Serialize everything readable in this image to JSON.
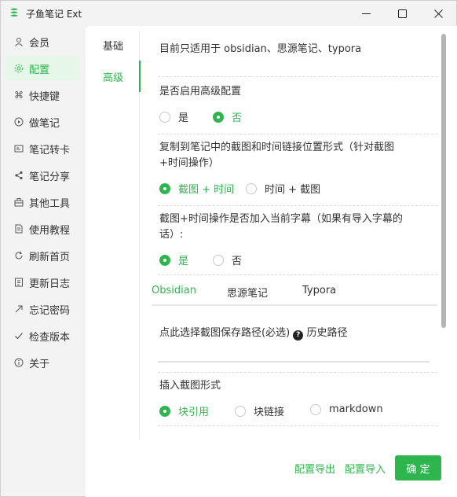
{
  "window": {
    "title": "子鱼笔记 Ext",
    "controls": {
      "minimize": "minimize-icon",
      "maximize": "maximize-icon",
      "close": "close-icon"
    }
  },
  "sidebar": {
    "items": [
      {
        "label": "会员",
        "icon": "user-icon"
      },
      {
        "label": "配置",
        "icon": "gear-icon",
        "active": true
      },
      {
        "label": "快捷键",
        "icon": "command-icon"
      },
      {
        "label": "做笔记",
        "icon": "play-circle-icon"
      },
      {
        "label": "笔记转卡",
        "icon": "card-icon"
      },
      {
        "label": "笔记分享",
        "icon": "share-icon"
      },
      {
        "label": "其他工具",
        "icon": "toolbox-icon"
      },
      {
        "label": "使用教程",
        "icon": "document-icon"
      },
      {
        "label": "刷新首页",
        "icon": "refresh-icon"
      },
      {
        "label": "更新日志",
        "icon": "log-icon"
      },
      {
        "label": "忘记密码",
        "icon": "arrow-up-right-icon"
      },
      {
        "label": "检查版本",
        "icon": "check-icon"
      },
      {
        "label": "关于",
        "icon": "info-icon"
      }
    ]
  },
  "settings_tabs": [
    {
      "label": "基础"
    },
    {
      "label": "高级",
      "active": true
    }
  ],
  "content": {
    "note": "目前只适用于 obsidian、思源笔记、typora",
    "enable_advanced": {
      "question": "是否启用高级配置",
      "options": [
        "是",
        "否"
      ],
      "selected": "否"
    },
    "link_position": {
      "question_line1": "复制到笔记中的截图和时间链接位置形式（针对截图",
      "question_line2": "+时间操作）",
      "options": [
        "截图 + 时间",
        "时间 + 截图"
      ],
      "selected": "截图 + 时间"
    },
    "add_subtitle": {
      "question_line1": "截图+时间操作是否加入当前字幕（如果有导入字幕的",
      "question_line2": "话）:",
      "options": [
        "是",
        "否"
      ],
      "selected": "是"
    },
    "app_tabs": [
      {
        "label": "Obsidian",
        "active": true
      },
      {
        "label": "思源笔记"
      },
      {
        "label": "Typora"
      }
    ],
    "save_path": {
      "label": "点此选择截图保存路径(必选)",
      "help_icon": "question-circle-icon",
      "history_label": "历史路径",
      "value": ""
    },
    "insert_form": {
      "question": "插入截图形式",
      "options": [
        "块引用",
        "块链接",
        "markdown"
      ],
      "selected": "块引用"
    }
  },
  "footer": {
    "export_label": "配置导出",
    "import_label": "配置导入",
    "confirm_label": "确 定"
  },
  "colors": {
    "accent": "#2fb54e",
    "active_bg": "#e6f7ea"
  }
}
